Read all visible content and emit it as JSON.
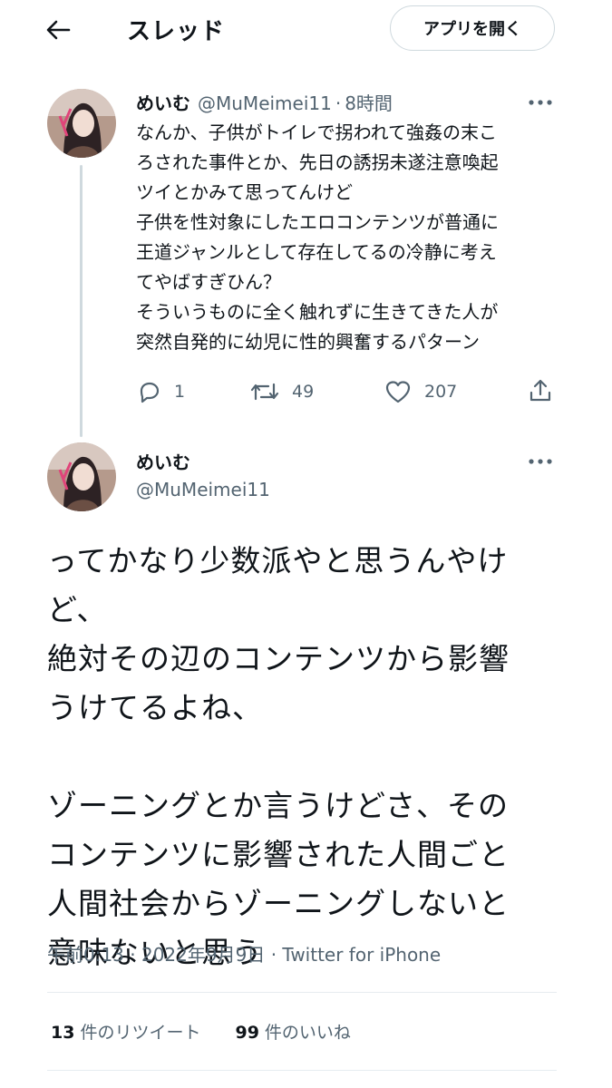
{
  "header": {
    "title": "スレッド",
    "open_app_label": "アプリを開く"
  },
  "tweet1": {
    "display_name": "めいむ",
    "handle": "@MuMeimei11",
    "separator": "·",
    "time": "8時間",
    "text": "なんか、子供がトイレで拐われて強姦の末こ\nろされた事件とか、先日の誘拐未遂注意喚起\nツイとかみて思ってんけど\n子供を性対象にしたエロコンテンツが普通に\n王道ジャンルとして存在してるの冷静に考え\nてやばすぎひん？\nそういうものに全く触れずに生きてきた人が\n突然自発的に幼児に性的興奮するパターン",
    "replies": "1",
    "retweets": "49",
    "likes": "207"
  },
  "tweet2": {
    "display_name": "めいむ",
    "handle": "@MuMeimei11",
    "text": "ってかなり少数派やと思うんやけ\nど、\n絶対その辺のコンテンツから影響\nうけてるよね、\n\nゾーニングとか言うけどさ、その\nコンテンツに影響された人間ごと\n人間社会からゾーニングしないと\n意味ないと思う",
    "timestamp": "午前0:13 · 2022年9月9日 · ",
    "source": "Twitter for iPhone",
    "retweet_count": "13",
    "retweet_label": "件のリツイート",
    "like_count": "99",
    "like_label": "件のいいね"
  },
  "colors": {
    "text_primary": "#0f1419",
    "text_secondary": "#536471",
    "border": "#cfd9de"
  }
}
